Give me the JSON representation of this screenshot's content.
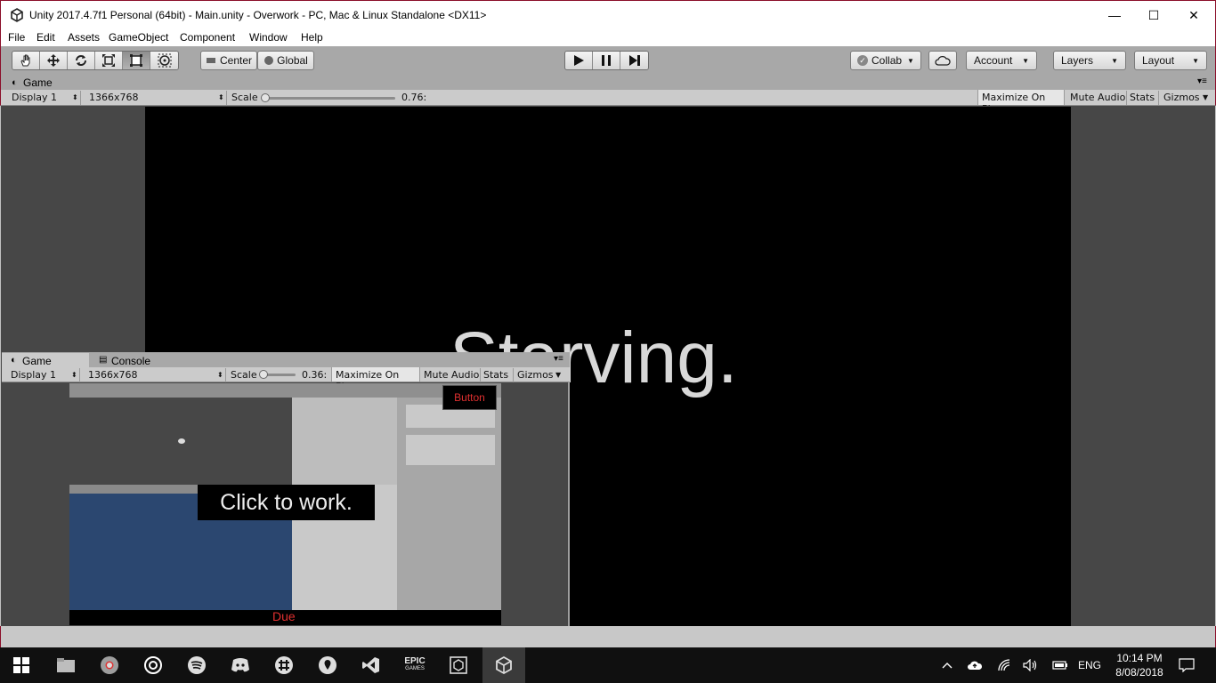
{
  "window": {
    "title": "Unity 2017.4.7f1 Personal (64bit) - Main.unity - Overwork - PC, Mac & Linux Standalone <DX11>",
    "controls": {
      "minimize": "—",
      "maximize": "☐",
      "close": "✕"
    }
  },
  "menu": [
    "File",
    "Edit",
    "Assets",
    "GameObject",
    "Component",
    "Window",
    "Help"
  ],
  "toolbar": {
    "pivot_label": "Center",
    "space_label": "Global",
    "collab_label": "Collab",
    "account_label": "Account",
    "layers_label": "Layers",
    "layout_label": "Layout",
    "active_tool_index": 4
  },
  "game_panel": {
    "tab_label": "Game",
    "display": "Display 1",
    "resolution": "1366x768",
    "scale_label": "Scale",
    "scale_value": "0.76:",
    "scale_slider_fraction": 0.0,
    "maximize_on_play": "Maximize On Play",
    "mute_audio": "Mute Audio",
    "stats": "Stats",
    "gizmos": "Gizmos",
    "game_text": "Starving."
  },
  "mini_panel": {
    "tab_game": "Game",
    "tab_console": "Console",
    "display": "Display 1",
    "resolution": "1366x768",
    "scale_label": "Scale",
    "scale_value": "0.36:",
    "maximize_on_play": "Maximize On Play",
    "mute_audio": "Mute Audio",
    "stats": "Stats",
    "gizmos": "Gizmos",
    "click_text": "Click to work.",
    "button_text": "Button",
    "due_text": "Due"
  },
  "taskbar": {
    "apps": [
      "file-explorer",
      "chrome",
      "groove",
      "spotify",
      "discord",
      "slack",
      "maps",
      "visual-studio",
      "epic-games",
      "unity-hub",
      "unity"
    ],
    "epic_label_top": "EPIC",
    "epic_label_bottom": "GAMES",
    "language": "ENG",
    "time": "10:14 PM",
    "date": "8/08/2018"
  },
  "colors": {
    "accent_red": "#e03030",
    "game_bg": "#000000",
    "panel_bg": "#474747",
    "mini_blue": "#2b4770"
  }
}
